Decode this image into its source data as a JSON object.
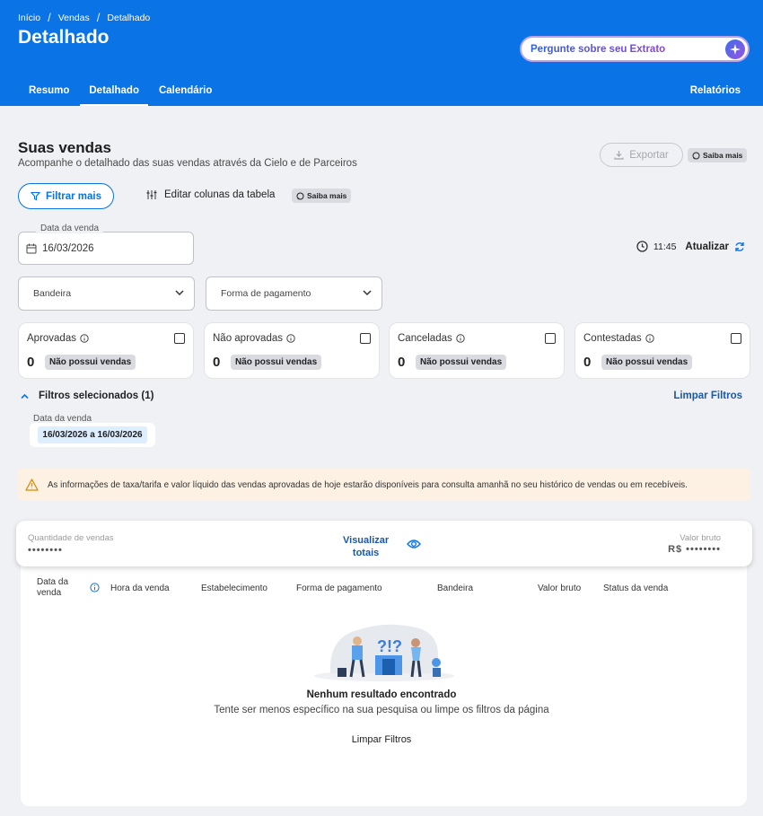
{
  "header": {
    "breadcrumb": [
      "Início",
      "Vendas",
      "Detalhado"
    ],
    "title": "Detalhado",
    "ask_placeholder": "Pergunte sobre seu Extrato",
    "tabs": [
      "Resumo",
      "Detalhado",
      "Calendário"
    ],
    "active_tab": "Detalhado",
    "reports_label": "Relatórios",
    "brand_color": "#0a73e6"
  },
  "section": {
    "title": "Suas vendas",
    "subtitle": "Acompanhe o detalhado das suas vendas através da Cielo e de Parceiros",
    "export_label": "Exportar",
    "saiba_mais": "Saiba mais",
    "filter_label": "Filtrar mais",
    "edit_columns_label": "Editar colunas da tabela"
  },
  "date_filter": {
    "label": "Data da venda",
    "value": "16/03/2026"
  },
  "refresh": {
    "time": "11:45",
    "label": "Atualizar"
  },
  "selects": {
    "bandeira": "Bandeira",
    "forma_pagamento": "Forma de pagamento"
  },
  "status_cards": [
    {
      "title": "Aprovadas",
      "count": "0",
      "note": "Não possui vendas"
    },
    {
      "title": "Não aprovadas",
      "count": "0",
      "note": "Não possui vendas"
    },
    {
      "title": "Canceladas",
      "count": "0",
      "note": "Não possui vendas"
    },
    {
      "title": "Contestadas",
      "count": "0",
      "note": "Não possui vendas"
    }
  ],
  "selected_filters": {
    "title": "Filtros selecionados (1)",
    "clear_label": "Limpar Filtros",
    "item_label": "Data da venda",
    "item_value": "16/03/2026 a 16/03/2026"
  },
  "warning": {
    "text": "As informações de taxa/tarifa e valor líquido das vendas aprovadas de hoje estarão disponíveis para consulta amanhã no seu histórico de vendas ou em recebíveis."
  },
  "totals": {
    "qty_label": "Quantidade de vendas",
    "qty_value": "••••••••",
    "visualize_line1": "Visualizar",
    "visualize_line2": "totais",
    "gross_label": "Valor bruto",
    "gross_value": "R$ ••••••••"
  },
  "table": {
    "columns": [
      "Data da venda",
      "Hora da venda",
      "Estabelecimento",
      "Forma de pagamento",
      "Bandeira",
      "Valor bruto",
      "Status da venda"
    ]
  },
  "empty_state": {
    "title": "Nenhum resultado encontrado",
    "subtitle": "Tente ser menos específico na sua pesquisa ou limpe os filtros da página",
    "clear_label": "Limpar Filtros"
  }
}
